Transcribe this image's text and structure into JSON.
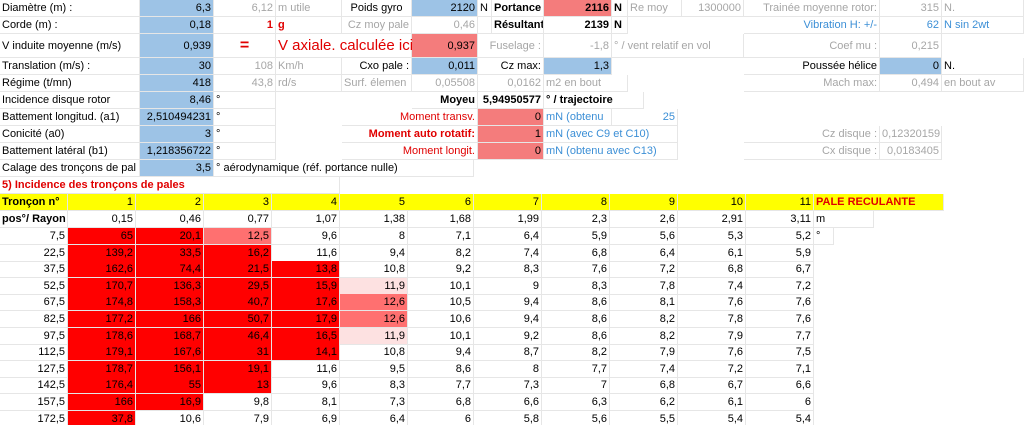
{
  "top": {
    "r1": {
      "label": "Diamètre  (m) :",
      "val": "6,3",
      "g1": "6,12",
      "g1u": "m utile",
      "label2": "Poids gyro",
      "val2": "2120",
      "u2": "N",
      "label3": "Portance",
      "val3": "2116",
      "u3": "N",
      "label4": "Re moy",
      "val4": "1300000",
      "label5": "Trainée moyenne rotor:",
      "val5": "315",
      "u5": "N."
    },
    "r2": {
      "label": "Corde (m) :",
      "val": "0,18",
      "rn": "1",
      "rnu": "g",
      "label2": "Cz moy pale",
      "val2": "0,46",
      "label3": "Résultante",
      "val3": "2139",
      "u3": "N",
      "label4": "Vibration H: +/-",
      "val4": "62",
      "u4": "N sin 2wt"
    },
    "r3": {
      "label": "V induite  moyenne (m/s)",
      "val": "0,939",
      "eq": "=",
      "vax": "V axiale. calculée ici",
      "val2": "0,937",
      "label3": "Fuselage :",
      "val3": "-1,8",
      "u3": "° / vent relatif en vol",
      "label4": "Coef mu :",
      "val4": "0,215"
    },
    "r4": {
      "label": "Translation (m/s) :",
      "val": "30",
      "g1": "108",
      "g1u": "Km/h",
      "label2": "Cxo pale :",
      "val2": "0,011",
      "label3": "Cz max:",
      "val3": "1,3",
      "label4": "Poussée hélice",
      "val4": "0",
      "u4": "N."
    },
    "r5": {
      "label": "Régime (t/mn)",
      "val": "418",
      "g1": "43,8",
      "g1u": "rd/s",
      "label2": "Surf. élemen",
      "val2": "0,05508",
      "val3": "0,0162",
      "u3": "m2 en  bout",
      "label4": "Mach max:",
      "val4": "0,494",
      "u4": "en bout av"
    },
    "r6": {
      "label": "Incidence disque rotor",
      "val": "8,46",
      "u": "°",
      "label2": "Moyeu",
      "val2": "5,94950577",
      "u2": "° / trajectoire"
    },
    "r7": {
      "label": "Battement longitud. (a1)",
      "val": "2,510494231",
      "u": "°",
      "label2": "Moment transv.",
      "val2": "0",
      "u2": "mN  (obtenu",
      "val3": "25"
    },
    "r8": {
      "label": "Conicité (a0)",
      "val": "3",
      "u": "°",
      "label2": "Moment auto rotatif:",
      "val2": "1",
      "u2": "mN  (avec C9 et C10)",
      "label3": "Cz disque :",
      "val3": "0,12320159"
    },
    "r9": {
      "label": "Battement latéral  (b1)",
      "val": "1,218356722",
      "u": "°",
      "label2": "Moment longit.",
      "val2": "0",
      "u2": "mN (obtenu avec C13)",
      "label3": "Cx disque :",
      "val3": "0,0183405"
    },
    "r10": {
      "label": "Calage des tronçons de pal",
      "val": "3,5",
      "u": "° aérodynamique (réf. portance nulle)"
    }
  },
  "section_title": "5) Incidence des tronçons  de pales",
  "troncon_label": "Tronçon n°",
  "troncons": [
    "1",
    "2",
    "3",
    "4",
    "5",
    "6",
    "7",
    "8",
    "9",
    "10",
    "11"
  ],
  "pale_reculante": "PALE RECULANTE",
  "pos_label": "pos°/ Rayon",
  "radii": [
    "0,15",
    "0,46",
    "0,77",
    "1,07",
    "1,38",
    "1,68",
    "1,99",
    "2,3",
    "2,6",
    "2,91",
    "3,11"
  ],
  "radii_unit": "m",
  "deg_mark": "°",
  "rows": [
    {
      "pos": "7,5",
      "v": [
        "65",
        "20,1",
        "12,5",
        "9,6",
        "8",
        "7,1",
        "6,4",
        "5,9",
        "5,6",
        "5,3",
        "5,2"
      ]
    },
    {
      "pos": "22,5",
      "v": [
        "139,2",
        "33,5",
        "16,2",
        "11,6",
        "9,4",
        "8,2",
        "7,4",
        "6,8",
        "6,4",
        "6,1",
        "5,9"
      ]
    },
    {
      "pos": "37,5",
      "v": [
        "162,6",
        "74,4",
        "21,5",
        "13,8",
        "10,8",
        "9,2",
        "8,3",
        "7,6",
        "7,2",
        "6,8",
        "6,7"
      ]
    },
    {
      "pos": "52,5",
      "v": [
        "170,7",
        "136,3",
        "29,5",
        "15,9",
        "11,9",
        "10,1",
        "9",
        "8,3",
        "7,8",
        "7,4",
        "7,2"
      ]
    },
    {
      "pos": "67,5",
      "v": [
        "174,8",
        "158,3",
        "40,7",
        "17,6",
        "12,6",
        "10,5",
        "9,4",
        "8,6",
        "8,1",
        "7,6",
        "7,6"
      ]
    },
    {
      "pos": "82,5",
      "v": [
        "177,2",
        "166",
        "50,7",
        "17,9",
        "12,6",
        "10,6",
        "9,4",
        "8,6",
        "8,2",
        "7,8",
        "7,6"
      ]
    },
    {
      "pos": "97,5",
      "v": [
        "178,6",
        "168,7",
        "46,4",
        "16,5",
        "11,9",
        "10,1",
        "9,2",
        "8,6",
        "8,2",
        "7,9",
        "7,7"
      ]
    },
    {
      "pos": "112,5",
      "v": [
        "179,1",
        "167,6",
        "31",
        "14,1",
        "10,8",
        "9,4",
        "8,7",
        "8,2",
        "7,9",
        "7,6",
        "7,5"
      ]
    },
    {
      "pos": "127,5",
      "v": [
        "178,7",
        "156,1",
        "19,1",
        "11,6",
        "9,5",
        "8,6",
        "8",
        "7,7",
        "7,4",
        "7,2",
        "7,1"
      ]
    },
    {
      "pos": "142,5",
      "v": [
        "176,4",
        "55",
        "13",
        "9,6",
        "8,3",
        "7,7",
        "7,3",
        "7",
        "6,8",
        "6,7",
        "6,6"
      ]
    },
    {
      "pos": "157,5",
      "v": [
        "166",
        "16,9",
        "9,8",
        "8,1",
        "7,3",
        "6,8",
        "6,6",
        "6,3",
        "6,2",
        "6,1",
        "6"
      ]
    },
    {
      "pos": "172,5",
      "v": [
        "37,8",
        "10,6",
        "7,9",
        "6,9",
        "6,4",
        "6",
        "5,8",
        "5,6",
        "5,5",
        "5,4",
        "5,4"
      ]
    }
  ]
}
